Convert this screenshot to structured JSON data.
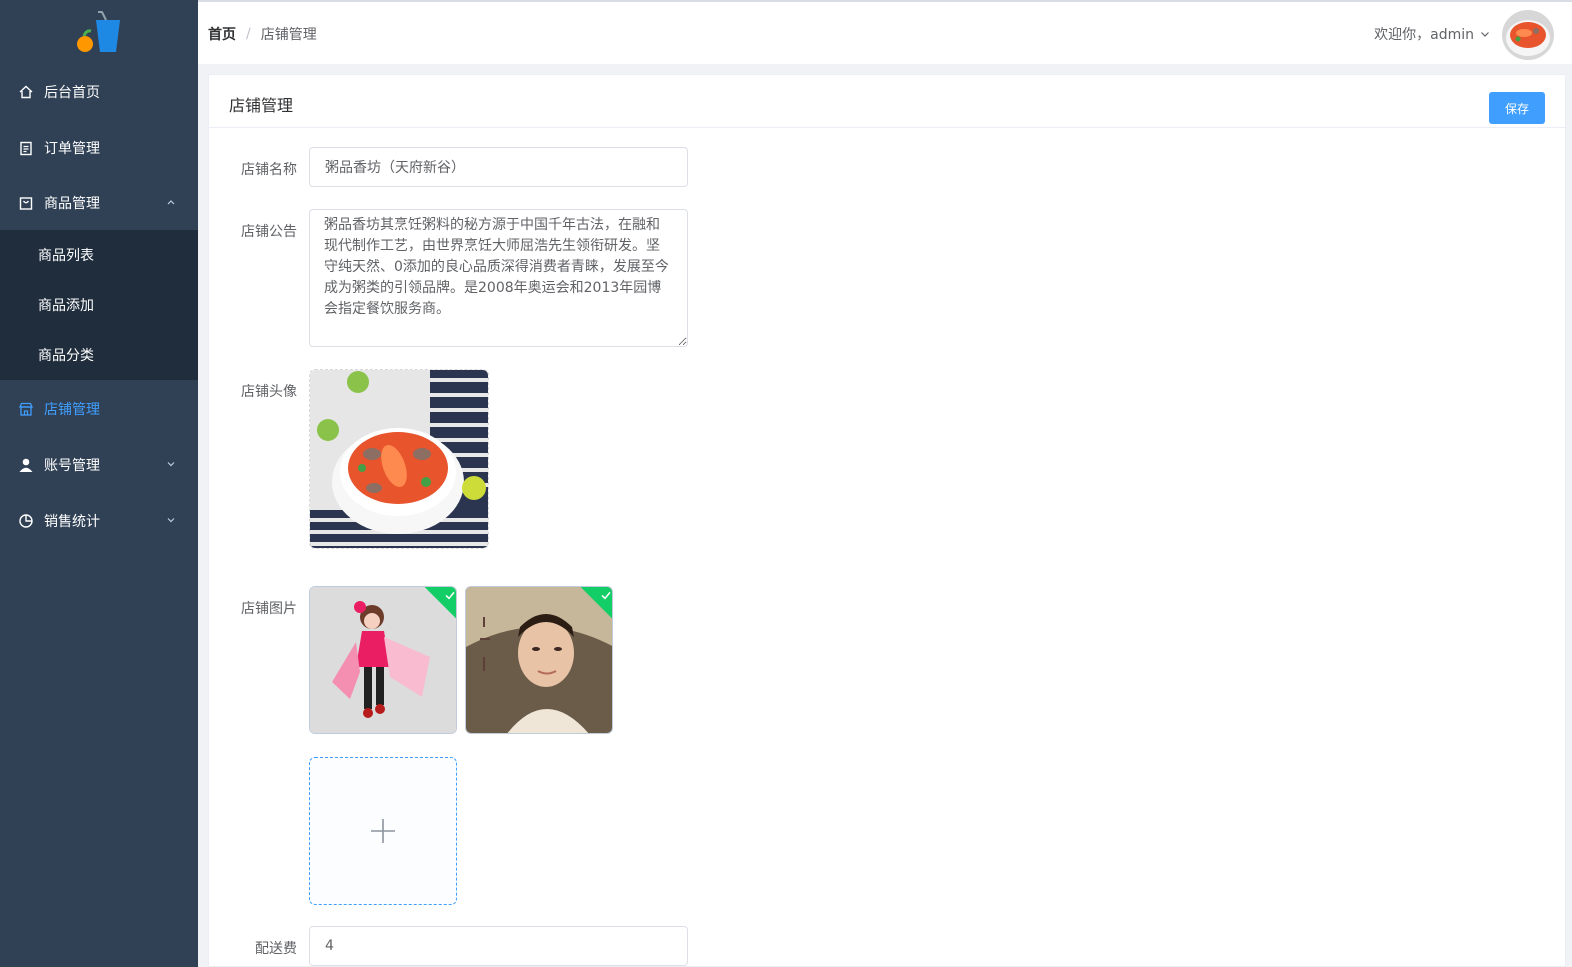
{
  "sidebar": {
    "logo_icon": "juice-cup-logo-icon",
    "items": [
      {
        "label": "后台首页",
        "icon": "home-icon"
      },
      {
        "label": "订单管理",
        "icon": "clipboard-icon"
      },
      {
        "label": "商品管理",
        "icon": "bag-icon",
        "expanded": true
      },
      {
        "label": "店铺管理",
        "icon": "shop-icon",
        "active": true
      },
      {
        "label": "账号管理",
        "icon": "user-icon"
      },
      {
        "label": "销售统计",
        "icon": "pie-chart-icon"
      }
    ],
    "goods_submenu": [
      "商品列表",
      "商品添加",
      "商品分类"
    ],
    "active_color": "#409eff",
    "background": "#304156"
  },
  "header": {
    "breadcrumb": {
      "home": "首页",
      "separator": "/",
      "current": "店铺管理"
    },
    "welcome": "欢迎你，admin"
  },
  "card": {
    "title": "店铺管理",
    "save_label": "保存"
  },
  "form": {
    "name_label": "店铺名称",
    "name_value": "粥品香坊（天府新谷）",
    "notice_label": "店铺公告",
    "notice_value": "粥品香坊其烹饪粥料的秘方源于中国千年古法，在融和现代制作工艺，由世界烹饪大师屈浩先生领衔研发。坚守纯天然、0添加的良心品质深得消费者青睐，发展至今成为粥类的引领品牌。是2008年奥运会和2013年园博会指定餐饮服务商。",
    "avatar_label": "店铺头像",
    "pics_label": "店铺图片",
    "delivery_label": "配送费",
    "delivery_value": "4"
  }
}
